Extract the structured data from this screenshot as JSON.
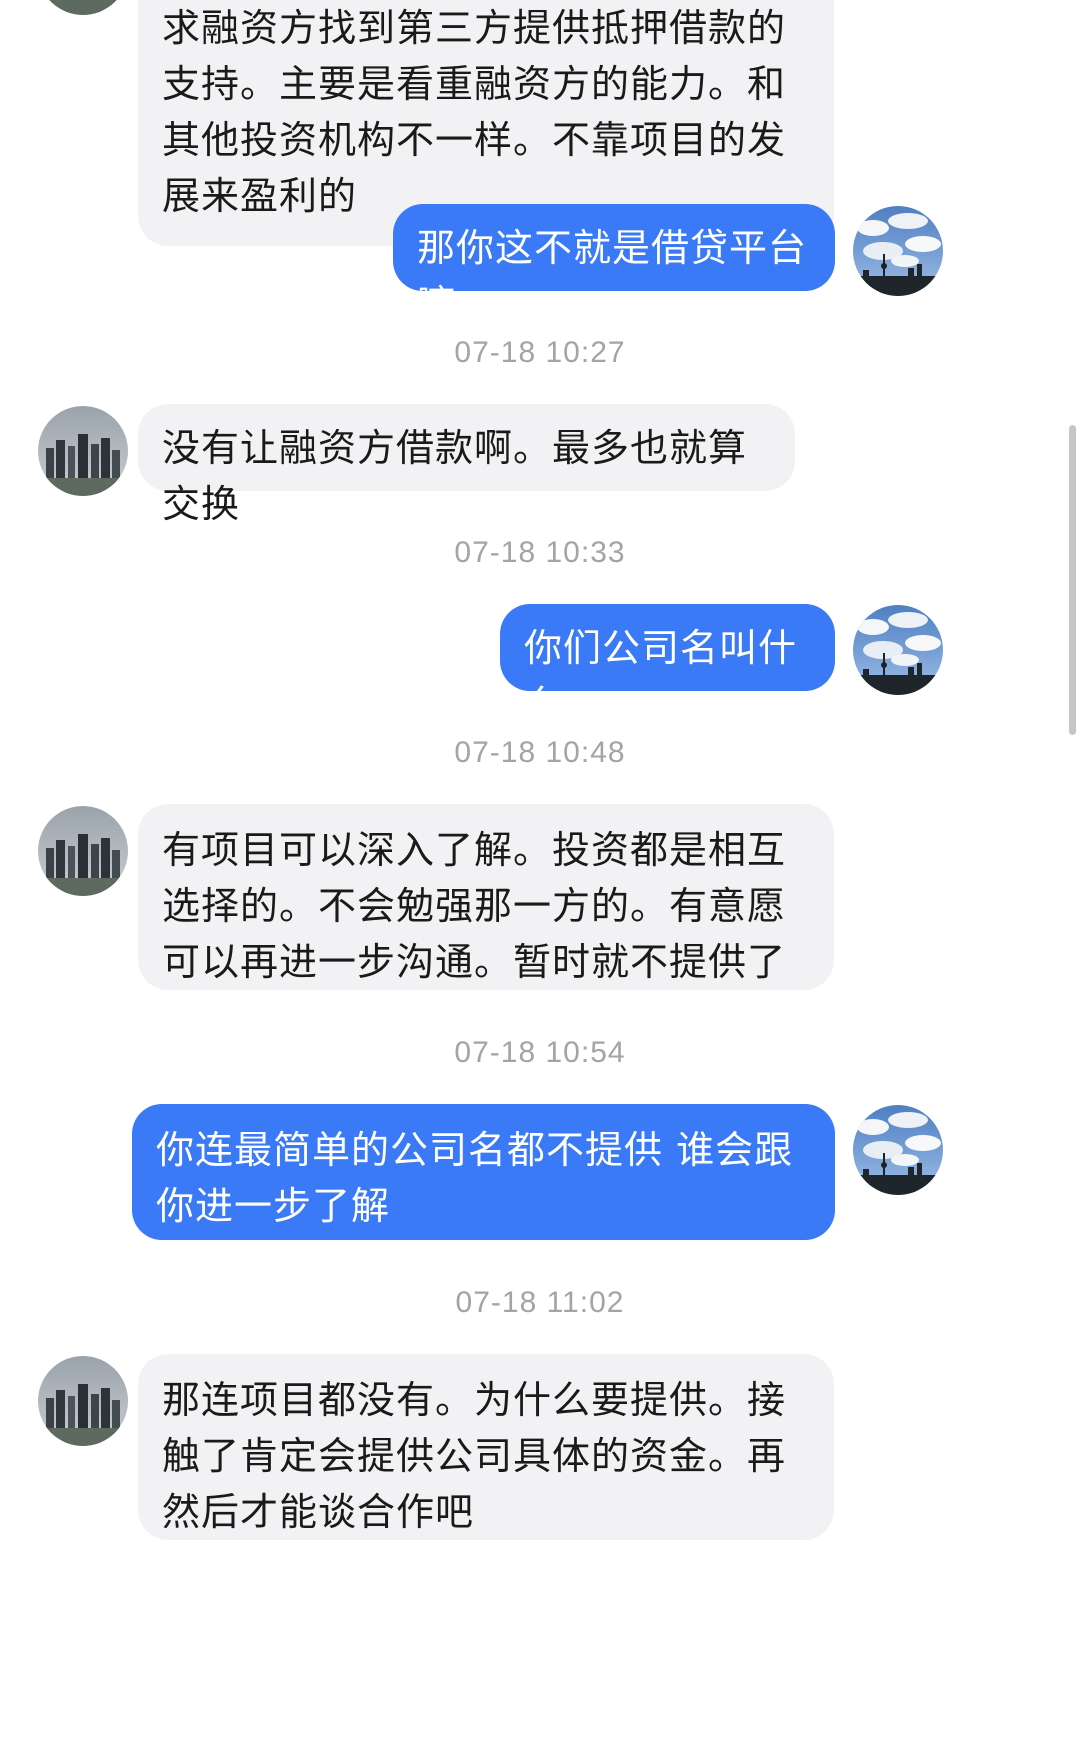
{
  "messages": [
    {
      "side": "in",
      "text": "求融资方找到第三方提供抵押借款的支持。主要是看重融资方的能力。和其他投资机构不一样。不靠项目的发展来盈利的"
    },
    {
      "side": "out",
      "text": "那你这不就是借贷平台嘛"
    },
    {
      "timestamp": "07-18 10:27"
    },
    {
      "side": "in",
      "text": "没有让融资方借款啊。最多也就算交换"
    },
    {
      "timestamp": "07-18 10:33"
    },
    {
      "side": "out",
      "text": "你们公司名叫什么"
    },
    {
      "timestamp": "07-18 10:48"
    },
    {
      "side": "in",
      "text": "有项目可以深入了解。投资都是相互选择的。不会勉强那一方的。有意愿可以再进一步沟通。暂时就不提供了"
    },
    {
      "timestamp": "07-18 10:54"
    },
    {
      "side": "out",
      "text": "你连最简单的公司名都不提供 谁会跟你进一步了解"
    },
    {
      "timestamp": "07-18 11:02"
    },
    {
      "side": "in",
      "text": "那连项目都没有。为什么要提供。接触了肯定会提供公司具体的资金。再然后才能谈合作吧"
    }
  ],
  "icons": {
    "contact_avatar": "city-skyline-avatar",
    "self_avatar": "tv-tower-sky-avatar"
  },
  "colors": {
    "outgoing_bubble": "#3b7af6",
    "incoming_bubble": "#f2f2f4",
    "timestamp_text": "#a3a3a8"
  }
}
